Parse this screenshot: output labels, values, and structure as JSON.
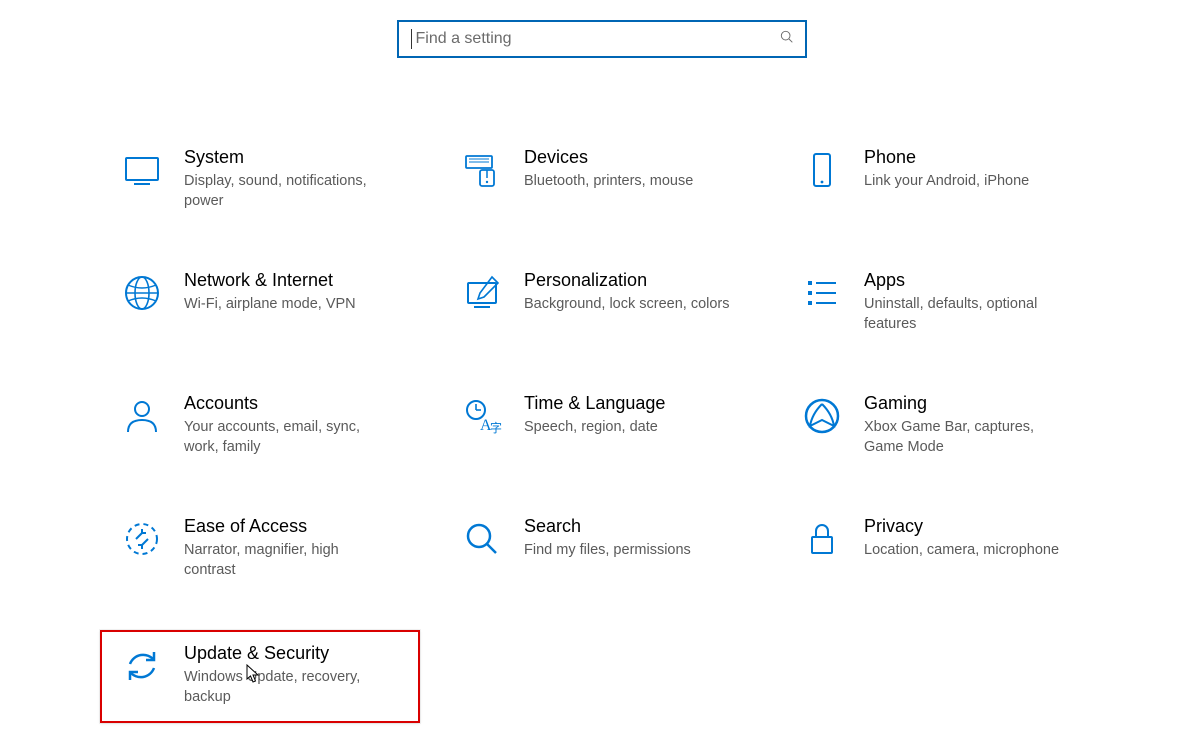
{
  "colors": {
    "accent": "#0078d4",
    "highlight_border": "#d90000"
  },
  "search": {
    "placeholder": "Find a setting"
  },
  "tiles": {
    "system": {
      "title": "System",
      "desc": "Display, sound, notifications, power"
    },
    "devices": {
      "title": "Devices",
      "desc": "Bluetooth, printers, mouse"
    },
    "phone": {
      "title": "Phone",
      "desc": "Link your Android, iPhone"
    },
    "network": {
      "title": "Network & Internet",
      "desc": "Wi-Fi, airplane mode, VPN"
    },
    "personalization": {
      "title": "Personalization",
      "desc": "Background, lock screen, colors"
    },
    "apps": {
      "title": "Apps",
      "desc": "Uninstall, defaults, optional features"
    },
    "accounts": {
      "title": "Accounts",
      "desc": "Your accounts, email, sync, work, family"
    },
    "time": {
      "title": "Time & Language",
      "desc": "Speech, region, date"
    },
    "gaming": {
      "title": "Gaming",
      "desc": "Xbox Game Bar, captures, Game Mode"
    },
    "ease": {
      "title": "Ease of Access",
      "desc": "Narrator, magnifier, high contrast"
    },
    "search_cat": {
      "title": "Search",
      "desc": "Find my files, permissions"
    },
    "privacy": {
      "title": "Privacy",
      "desc": "Location, camera, microphone"
    },
    "update": {
      "title": "Update & Security",
      "desc": "Windows Update, recovery, backup"
    }
  },
  "annotations": {
    "highlighted_tile": "update",
    "mouse_cursor": true
  }
}
